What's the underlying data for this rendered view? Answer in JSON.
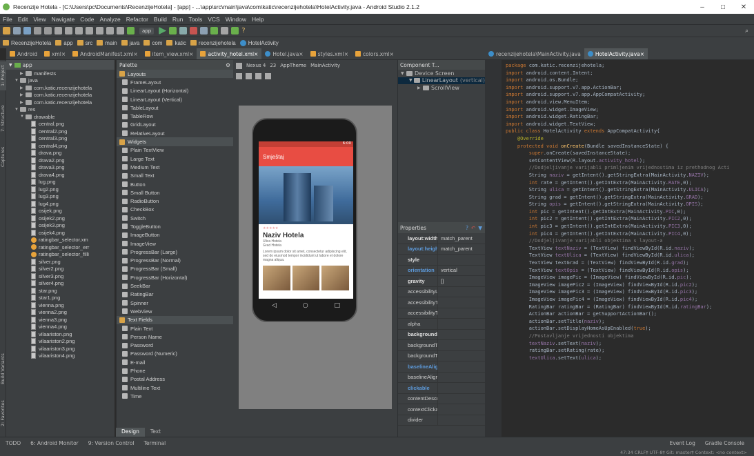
{
  "window": {
    "title": "Recenzije Hotela - [C:\\Users\\pc\\Documents\\RecenzijeHotela] - [app] - ...\\app\\src\\main\\java\\com\\katic\\recenzijehotela\\HotelActivity.java - Android Studio 2.1.2"
  },
  "menu": [
    "File",
    "Edit",
    "View",
    "Navigate",
    "Code",
    "Analyze",
    "Refactor",
    "Build",
    "Run",
    "Tools",
    "VCS",
    "Window",
    "Help"
  ],
  "toolbar": {
    "run_config": "app"
  },
  "breadcrumbs": [
    "RecenzijeHotela",
    "app",
    "src",
    "main",
    "java",
    "com",
    "katic",
    "recenzijehotela",
    "HotelActivity"
  ],
  "left_tabs": [
    "Android",
    "xml",
    "AndroidManifest.xml",
    "item_view.xml",
    "activity_hotel.xml",
    "Hotel.java",
    "styles.xml",
    "colors.xml"
  ],
  "right_tabs": [
    "recenzijehotela\\MainActivity.java",
    "HotelActivity.java"
  ],
  "side_labels": [
    "1: Project",
    "7: Structure",
    "Captures",
    "Build Variants",
    "2: Favorites"
  ],
  "project": {
    "root": "app",
    "rows": [
      {
        "label": "manifests",
        "indent": 2,
        "kind": "folder"
      },
      {
        "label": "java",
        "indent": 1,
        "kind": "folder"
      },
      {
        "label": "com.katic.recenzijehotela",
        "indent": 2,
        "kind": "folder"
      },
      {
        "label": "com.katic.recenzijehotela",
        "indent": 2,
        "kind": "folder"
      },
      {
        "label": "com.katic.recenzijehotela",
        "indent": 2,
        "kind": "folder"
      },
      {
        "label": "res",
        "indent": 1,
        "kind": "folder"
      },
      {
        "label": "drawable",
        "indent": 2,
        "kind": "folder"
      },
      {
        "label": "central.png",
        "indent": 4,
        "kind": "png"
      },
      {
        "label": "central2.png",
        "indent": 4,
        "kind": "png"
      },
      {
        "label": "central3.png",
        "indent": 4,
        "kind": "png"
      },
      {
        "label": "central4.png",
        "indent": 4,
        "kind": "png"
      },
      {
        "label": "drava.png",
        "indent": 4,
        "kind": "png"
      },
      {
        "label": "drava2.png",
        "indent": 4,
        "kind": "png"
      },
      {
        "label": "drava3.png",
        "indent": 4,
        "kind": "png"
      },
      {
        "label": "drava4.png",
        "indent": 4,
        "kind": "png"
      },
      {
        "label": "lug.png",
        "indent": 4,
        "kind": "png"
      },
      {
        "label": "lug2.png",
        "indent": 4,
        "kind": "png"
      },
      {
        "label": "lug3.png",
        "indent": 4,
        "kind": "png"
      },
      {
        "label": "lug4.png",
        "indent": 4,
        "kind": "png"
      },
      {
        "label": "osijek.png",
        "indent": 4,
        "kind": "png"
      },
      {
        "label": "osijek2.png",
        "indent": 4,
        "kind": "png"
      },
      {
        "label": "osijek3.png",
        "indent": 4,
        "kind": "png"
      },
      {
        "label": "osijek4.png",
        "indent": 4,
        "kind": "png"
      },
      {
        "label": "ratingbar_selector.xm",
        "indent": 4,
        "kind": "xml"
      },
      {
        "label": "ratingbar_selector_err",
        "indent": 4,
        "kind": "xml"
      },
      {
        "label": "ratingbar_selector_filli",
        "indent": 4,
        "kind": "xml"
      },
      {
        "label": "silver.png",
        "indent": 4,
        "kind": "png"
      },
      {
        "label": "silver2.png",
        "indent": 4,
        "kind": "png"
      },
      {
        "label": "silver3.png",
        "indent": 4,
        "kind": "png"
      },
      {
        "label": "silver4.png",
        "indent": 4,
        "kind": "png"
      },
      {
        "label": "star.png",
        "indent": 4,
        "kind": "png"
      },
      {
        "label": "star1.png",
        "indent": 4,
        "kind": "png"
      },
      {
        "label": "vienna.png",
        "indent": 4,
        "kind": "png"
      },
      {
        "label": "vienna2.png",
        "indent": 4,
        "kind": "png"
      },
      {
        "label": "vienna3.png",
        "indent": 4,
        "kind": "png"
      },
      {
        "label": "vienna4.png",
        "indent": 4,
        "kind": "png"
      },
      {
        "label": "vilaariston.png",
        "indent": 4,
        "kind": "png"
      },
      {
        "label": "vilaariston2.png",
        "indent": 4,
        "kind": "png"
      },
      {
        "label": "vilaariston3.png",
        "indent": 4,
        "kind": "png"
      },
      {
        "label": "vilaariston4.png",
        "indent": 4,
        "kind": "png"
      }
    ]
  },
  "palette": {
    "header": "Palette",
    "items": [
      {
        "label": "Layouts",
        "cat": true
      },
      {
        "label": "FrameLayout"
      },
      {
        "label": "LinearLayout (Horizontal)"
      },
      {
        "label": "LinearLayout (Vertical)"
      },
      {
        "label": "TableLayout"
      },
      {
        "label": "TableRow"
      },
      {
        "label": "GridLayout"
      },
      {
        "label": "RelativeLayout"
      },
      {
        "label": "Widgets",
        "cat": true
      },
      {
        "label": "Plain TextView"
      },
      {
        "label": "Large Text"
      },
      {
        "label": "Medium Text"
      },
      {
        "label": "Small Text"
      },
      {
        "label": "Button"
      },
      {
        "label": "Small Button"
      },
      {
        "label": "RadioButton"
      },
      {
        "label": "CheckBox"
      },
      {
        "label": "Switch"
      },
      {
        "label": "ToggleButton"
      },
      {
        "label": "ImageButton"
      },
      {
        "label": "ImageView"
      },
      {
        "label": "ProgressBar (Large)"
      },
      {
        "label": "ProgressBar (Normal)"
      },
      {
        "label": "ProgressBar (Small)"
      },
      {
        "label": "ProgressBar (Horizontal)"
      },
      {
        "label": "SeekBar"
      },
      {
        "label": "RatingBar"
      },
      {
        "label": "Spinner"
      },
      {
        "label": "WebView"
      },
      {
        "label": "Text Fields",
        "cat": true
      },
      {
        "label": "Plain Text"
      },
      {
        "label": "Person Name"
      },
      {
        "label": "Password"
      },
      {
        "label": "Password (Numeric)"
      },
      {
        "label": "E-mail"
      },
      {
        "label": "Phone"
      },
      {
        "label": "Postal Address"
      },
      {
        "label": "Multiline Text"
      },
      {
        "label": "Time"
      }
    ],
    "design_tab": "Design",
    "text_tab": "Text"
  },
  "designer": {
    "device": "Nexus 4",
    "api": "23",
    "theme": "AppTheme",
    "activity": "MainActivity",
    "phone": {
      "status_time": "6:00",
      "appbar_title": "Smještaj",
      "hotel_name": "Naziv Hotela",
      "street": "Ulica Hotela",
      "city": "Grad Hotela",
      "lorem": "Lorem ipsum dolor sit amet, consectetur adipiscing elit, sed do eiusmod tempor incididunt ut labore et dolore magna aliqua.",
      "nav_back": "◁",
      "nav_home": "○",
      "nav_recent": "□"
    }
  },
  "component_tree": {
    "header": "Component T...",
    "items": [
      {
        "label": "Device Screen",
        "indent": 0
      },
      {
        "label": "LinearLayout",
        "extra": "(vertical)",
        "indent": 1
      },
      {
        "label": "ScrollView",
        "indent": 2
      }
    ]
  },
  "properties": {
    "header": "Properties",
    "rows": [
      {
        "k": "layout:width",
        "v": "match_parent",
        "style": "b"
      },
      {
        "k": "layout:heigh",
        "v": "match_parent",
        "style": "hl"
      },
      {
        "k": "style",
        "v": "",
        "style": "b"
      },
      {
        "k": "orientation",
        "v": "vertical",
        "style": "hl"
      },
      {
        "k": "gravity",
        "v": "[]",
        "style": "b"
      },
      {
        "k": "accessibilityL",
        "v": ""
      },
      {
        "k": "accessibilityT",
        "v": ""
      },
      {
        "k": "accessibilityT",
        "v": ""
      },
      {
        "k": "alpha",
        "v": ""
      },
      {
        "k": "background",
        "v": "",
        "style": "b"
      },
      {
        "k": "backgroundT",
        "v": ""
      },
      {
        "k": "backgroundT",
        "v": ""
      },
      {
        "k": "baselineAlign",
        "v": "",
        "style": "hl"
      },
      {
        "k": "baselineAligr",
        "v": ""
      },
      {
        "k": "clickable",
        "v": "",
        "style": "hl"
      },
      {
        "k": "contentDescr",
        "v": ""
      },
      {
        "k": "contextClicka",
        "v": ""
      },
      {
        "k": "divider",
        "v": ""
      }
    ]
  },
  "editor": {
    "lines": [
      [
        [
          "kw",
          "package "
        ],
        [
          "",
          "com.katic.recenzijehotela;"
        ]
      ],
      [
        [
          "",
          ""
        ]
      ],
      [
        [
          "kw",
          "import "
        ],
        [
          "",
          "android.content.Intent;"
        ]
      ],
      [
        [
          "kw",
          "import "
        ],
        [
          "",
          "android.os.Bundle;"
        ]
      ],
      [
        [
          "kw",
          "import "
        ],
        [
          "",
          "android.support.v7.app.ActionBar;"
        ]
      ],
      [
        [
          "kw",
          "import "
        ],
        [
          "",
          "android.support.v7.app.AppCompatActivity;"
        ]
      ],
      [
        [
          "kw",
          "import "
        ],
        [
          "",
          "android.view.MenuItem;"
        ]
      ],
      [
        [
          "kw",
          "import "
        ],
        [
          "",
          "android.widget.ImageView;"
        ]
      ],
      [
        [
          "kw",
          "import "
        ],
        [
          "",
          "android.widget.RatingBar;"
        ]
      ],
      [
        [
          "kw",
          "import "
        ],
        [
          "",
          "android.widget.TextView;"
        ]
      ],
      [
        [
          "",
          ""
        ]
      ],
      [
        [
          "kw",
          "public class "
        ],
        [
          "",
          "HotelActivity "
        ],
        [
          "kw",
          "extends "
        ],
        [
          "",
          "AppCompatActivity{"
        ]
      ],
      [
        [
          "",
          ""
        ]
      ],
      [
        [
          "an",
          "    @Override"
        ]
      ],
      [
        [
          "kw",
          "    protected void "
        ],
        [
          "fn",
          "onCreate"
        ],
        [
          "",
          "(Bundle savedInstanceState) {"
        ]
      ],
      [
        [
          "kw",
          "        super"
        ],
        [
          "",
          ".onCreate(savedInstanceState);"
        ]
      ],
      [
        [
          "",
          ""
        ]
      ],
      [
        [
          "",
          "        setContentView(R.layout."
        ],
        [
          "fld",
          "activity_hotel"
        ],
        [
          "",
          ");"
        ]
      ],
      [
        [
          "",
          ""
        ]
      ],
      [
        [
          "cm",
          "        //Dodjeljivanje varijabli primljenim vrijednostima iz prethodnog Acti"
        ]
      ],
      [
        [
          "",
          "        String "
        ],
        [
          "fld",
          "naziv"
        ],
        [
          "",
          " = getIntent().getStringExtra(MainActivity."
        ],
        [
          "fld",
          "NAZIV"
        ],
        [
          "",
          ");"
        ]
      ],
      [
        [
          "kw",
          "        int "
        ],
        [
          "",
          "rate = getIntent().getIntExtra(MainActivity."
        ],
        [
          "fld",
          "RATE"
        ],
        [
          "",
          ",0);"
        ]
      ],
      [
        [
          "",
          "        String "
        ],
        [
          "fld",
          "ulica"
        ],
        [
          "",
          " = getIntent().getStringExtra(MainActivity."
        ],
        [
          "fld",
          "ULICA"
        ],
        [
          "",
          ");"
        ]
      ],
      [
        [
          "",
          "        String grad = getIntent().getStringExtra(MainActivity."
        ],
        [
          "fld",
          "GRAD"
        ],
        [
          "",
          ");"
        ]
      ],
      [
        [
          "",
          "        String "
        ],
        [
          "fld",
          "opis"
        ],
        [
          "",
          " = getIntent().getStringExtra(MainActivity."
        ],
        [
          "fld",
          "OPIS"
        ],
        [
          "",
          ");"
        ]
      ],
      [
        [
          "kw",
          "        int "
        ],
        [
          "",
          "pic = getIntent().getIntExtra(MainActivity."
        ],
        [
          "fld",
          "PIC"
        ],
        [
          "",
          ",0);"
        ]
      ],
      [
        [
          "kw",
          "        int "
        ],
        [
          "",
          "pic2 = getIntent().getIntExtra(MainActivity."
        ],
        [
          "fld",
          "PIC2"
        ],
        [
          "",
          ",0);"
        ]
      ],
      [
        [
          "kw",
          "        int "
        ],
        [
          "",
          "pic3 = getIntent().getIntExtra(MainActivity."
        ],
        [
          "fld",
          "PIC3"
        ],
        [
          "",
          ",0);"
        ]
      ],
      [
        [
          "kw",
          "        int "
        ],
        [
          "",
          "pic4 = getIntent().getIntExtra(MainActivity."
        ],
        [
          "fld",
          "PIC4"
        ],
        [
          "",
          ",0);"
        ]
      ],
      [
        [
          "",
          ""
        ]
      ],
      [
        [
          "cm",
          "        //Dodjeljivanje varijabli objektima s layout-a"
        ]
      ],
      [
        [
          "",
          "        TextView "
        ],
        [
          "fld",
          "textNaziv"
        ],
        [
          "",
          " = (TextView) findViewById(R.id."
        ],
        [
          "fld",
          "naziv"
        ],
        [
          "",
          ");"
        ]
      ],
      [
        [
          "",
          "        TextView "
        ],
        [
          "fld",
          "textUlica"
        ],
        [
          "",
          " = (TextView) findViewById(R.id."
        ],
        [
          "fld",
          "ulica"
        ],
        [
          "",
          ");"
        ]
      ],
      [
        [
          "",
          "        TextView textGrad = (TextView) findViewById(R.id."
        ],
        [
          "fld",
          "grad"
        ],
        [
          "",
          ");"
        ]
      ],
      [
        [
          "",
          "        TextView "
        ],
        [
          "fld",
          "textOpis"
        ],
        [
          "",
          " = (TextView) findViewById(R.id."
        ],
        [
          "fld",
          "opis"
        ],
        [
          "",
          ");"
        ]
      ],
      [
        [
          "",
          "        ImageView imagePic = (ImageView) findViewById(R.id."
        ],
        [
          "fld",
          "pic"
        ],
        [
          "",
          ");"
        ]
      ],
      [
        [
          "",
          "        ImageView imagePic2 = (ImageView) findViewById(R.id."
        ],
        [
          "fld",
          "pic2"
        ],
        [
          "",
          ");"
        ]
      ],
      [
        [
          "",
          "        ImageView imagePic3 = (ImageView) findViewById(R.id."
        ],
        [
          "fld",
          "pic3"
        ],
        [
          "",
          ");"
        ]
      ],
      [
        [
          "",
          "        ImageView imagePic4 = (ImageView) findViewById(R.id."
        ],
        [
          "fld",
          "pic4"
        ],
        [
          "",
          ");"
        ]
      ],
      [
        [
          "",
          "        RatingBar ratingBar = (RatingBar) findViewById(R.id."
        ],
        [
          "fld",
          "ratingBar"
        ],
        [
          "",
          ");"
        ]
      ],
      [
        [
          "",
          ""
        ]
      ],
      [
        [
          "",
          "        ActionBar actionBar = getSupportActionBar();"
        ]
      ],
      [
        [
          "",
          "        actionBar.setTitle("
        ],
        [
          "fld",
          "naziv"
        ],
        [
          "",
          ");"
        ]
      ],
      [
        [
          "",
          "        actionBar.setDisplayHomeAsUpEnabled("
        ],
        [
          "kw",
          "true"
        ],
        [
          "",
          ");"
        ]
      ],
      [
        [
          "",
          ""
        ]
      ],
      [
        [
          "cm",
          "        //Postavljanje vrijednosti objektima"
        ]
      ],
      [
        [
          "",
          "        "
        ],
        [
          "fld",
          "textNaziv"
        ],
        [
          "",
          ".setText("
        ],
        [
          "fld",
          "naziv"
        ],
        [
          "",
          ");"
        ]
      ],
      [
        [
          "",
          "        ratingBar.setRating(rate);"
        ]
      ],
      [
        [
          "",
          "        "
        ],
        [
          "fld",
          "textUlica"
        ],
        [
          "",
          ".setText("
        ],
        [
          "fld",
          "ulica"
        ],
        [
          "",
          ");"
        ]
      ]
    ]
  },
  "bottom_tools": [
    "TODO",
    "6: Android Monitor",
    "9: Version Control",
    "Terminal"
  ],
  "bottom_right": [
    "Event Log",
    "Gradle Console"
  ],
  "status": "47:34   CRLF‡   UTF-8‡   Git: master‡   Context: <no context>"
}
